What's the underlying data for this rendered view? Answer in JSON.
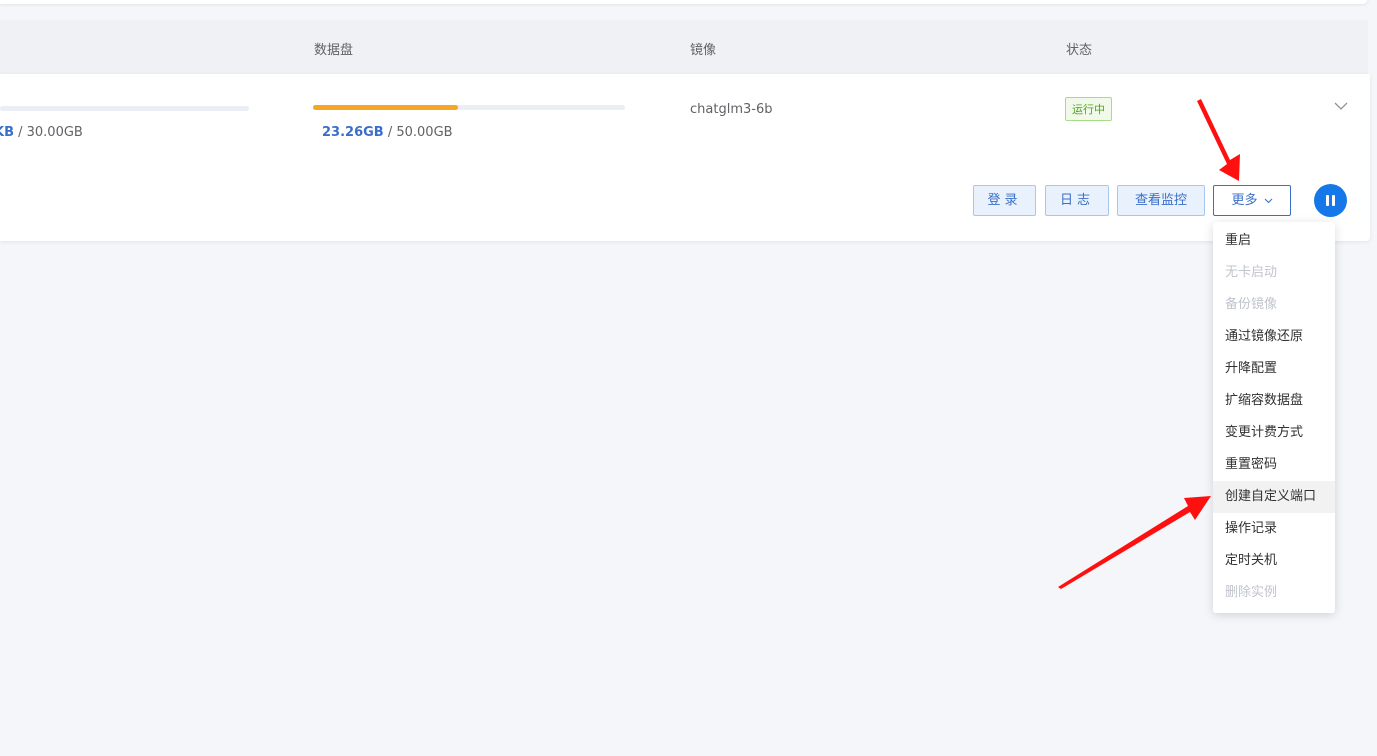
{
  "header": {
    "disk_label": "数据盘",
    "image_label": "镜像",
    "status_label": "状态"
  },
  "row": {
    "system_disk": {
      "used": "KB",
      "total": " / 30.00GB"
    },
    "data_disk": {
      "used": "23.26GB",
      "total": " / 50.00GB",
      "fill_fraction": 0.465
    },
    "image": "chatglm3-6b",
    "status": "运行中",
    "buttons": {
      "login": "登录",
      "log": "日志",
      "monitor": "查看监控",
      "more": "更多"
    }
  },
  "dropdown": {
    "items": [
      {
        "label": "重启",
        "disabled": false
      },
      {
        "label": "无卡启动",
        "disabled": true
      },
      {
        "label": "备份镜像",
        "disabled": true
      },
      {
        "label": "通过镜像还原",
        "disabled": false
      },
      {
        "label": "升降配置",
        "disabled": false
      },
      {
        "label": "扩缩容数据盘",
        "disabled": false
      },
      {
        "label": "变更计费方式",
        "disabled": false
      },
      {
        "label": "重置密码",
        "disabled": false
      },
      {
        "label": "创建自定义端口",
        "disabled": false
      },
      {
        "label": "操作记录",
        "disabled": false
      },
      {
        "label": "定时关机",
        "disabled": false
      },
      {
        "label": "删除实例",
        "disabled": true
      }
    ]
  },
  "colors": {
    "accent": "#3a6fc9",
    "progress": "#f5a623",
    "status_green": "#52a21f",
    "annotation_red": "#ff1010"
  }
}
